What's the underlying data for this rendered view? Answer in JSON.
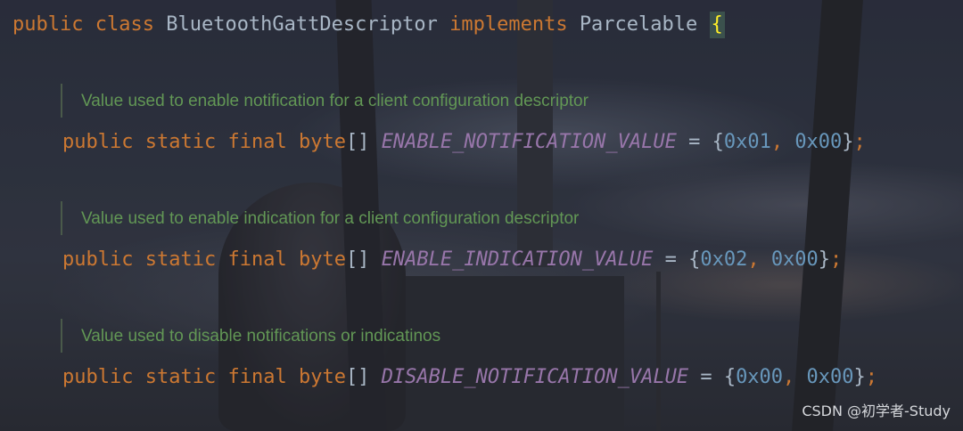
{
  "code": {
    "class_decl": {
      "kw_public": "public",
      "kw_class": "class",
      "class_name": "BluetoothGattDescriptor",
      "kw_implements": "implements",
      "interface_name": "Parcelable",
      "open_brace": "{"
    },
    "fields": [
      {
        "doc": "Value used to enable notification for a client configuration descriptor",
        "kw_public": "public",
        "kw_static": "static",
        "kw_final": "final",
        "type": "byte",
        "brackets": "[]",
        "name": "ENABLE_NOTIFICATION_VALUE",
        "equals": "=",
        "open": "{",
        "v1": "0x01",
        "comma": ",",
        "v2": "0x00",
        "close": "}",
        "semicolon": ";"
      },
      {
        "doc": "Value used to enable indication for a client configuration descriptor",
        "kw_public": "public",
        "kw_static": "static",
        "kw_final": "final",
        "type": "byte",
        "brackets": "[]",
        "name": "ENABLE_INDICATION_VALUE",
        "equals": "=",
        "open": "{",
        "v1": "0x02",
        "comma": ",",
        "v2": "0x00",
        "close": "}",
        "semicolon": ";"
      },
      {
        "doc": "Value used to disable notifications or indicatinos",
        "kw_public": "public",
        "kw_static": "static",
        "kw_final": "final",
        "type": "byte",
        "brackets": "[]",
        "name": "DISABLE_NOTIFICATION_VALUE",
        "equals": "=",
        "open": "{",
        "v1": "0x00",
        "comma": ",",
        "v2": "0x00",
        "close": "}",
        "semicolon": ";"
      }
    ]
  },
  "watermark": "CSDN @初学者-Study",
  "colors": {
    "keyword": "#cc7832",
    "identifier": "#a9b7c6",
    "constant": "#9876aa",
    "number": "#6897bb",
    "doc_comment": "#629755",
    "brace_highlight": "#ffef28"
  }
}
